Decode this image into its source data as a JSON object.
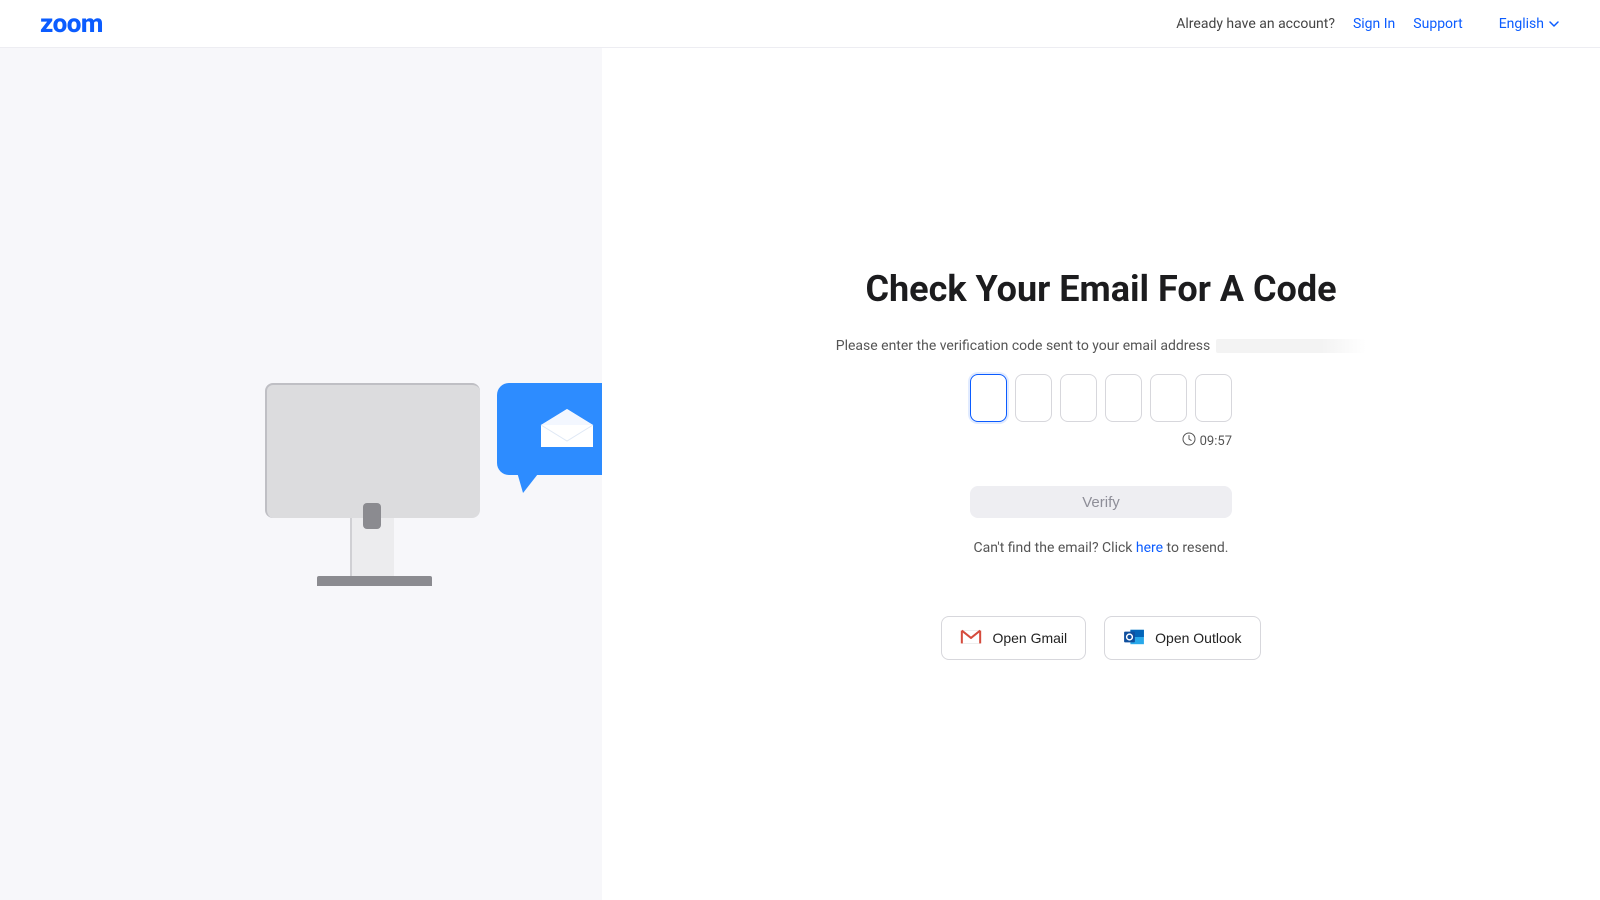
{
  "header": {
    "logo_text": "zoom",
    "prompt": "Already have an account?",
    "sign_in": "Sign In",
    "support": "Support",
    "language": "English"
  },
  "main": {
    "title": "Check Your Email For A Code",
    "instruction": "Please enter the verification code sent to your email address",
    "code_length": 6,
    "timer": "09:57",
    "verify_label": "Verify",
    "resend_pre": "Can't find the email? Click ",
    "resend_link": "here",
    "resend_post": " to resend.",
    "gmail_label": "Open Gmail",
    "outlook_label": "Open Outlook"
  }
}
